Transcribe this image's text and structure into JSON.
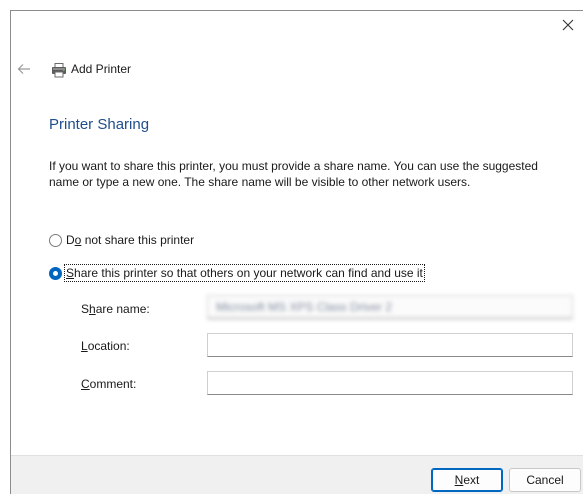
{
  "window": {
    "header_title": "Add Printer",
    "page_title": "Printer Sharing",
    "description": "If you want to share this printer, you must provide a share name. You can use the suggested name or type a new one. The share name will be visible to other network users."
  },
  "options": {
    "no_share": {
      "prefix": "D",
      "mnemonic": "o",
      "suffix": " not share this printer",
      "checked": false
    },
    "share": {
      "prefix": "",
      "mnemonic": "S",
      "suffix": "hare this printer so that others on your network can find and use it",
      "checked": true
    }
  },
  "fields": {
    "share_name": {
      "label_prefix": "S",
      "label_mnemonic": "h",
      "label_suffix": "are name:",
      "value": "Microsoft MS XPS Class Driver 2"
    },
    "location": {
      "label_prefix": "",
      "label_mnemonic": "L",
      "label_suffix": "ocation:",
      "value": ""
    },
    "comment": {
      "label_prefix": "",
      "label_mnemonic": "C",
      "label_suffix": "omment:",
      "value": ""
    }
  },
  "buttons": {
    "next_mnemonic": "N",
    "next_suffix": "ext",
    "cancel": "Cancel"
  },
  "colors": {
    "accent": "#0067c0",
    "title": "#1f4e8c"
  }
}
